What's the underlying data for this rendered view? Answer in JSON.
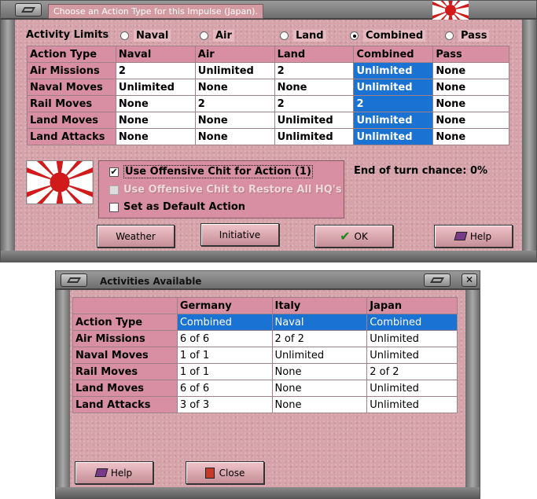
{
  "impulse_window": {
    "title": "Choose an Action Type for this Impulse (Japan).",
    "activity_limits_label": "Activity Limits",
    "radios": [
      {
        "label": "Naval",
        "selected": false
      },
      {
        "label": "Air",
        "selected": false
      },
      {
        "label": "Land",
        "selected": false
      },
      {
        "label": "Combined",
        "selected": true
      },
      {
        "label": "Pass",
        "selected": false
      }
    ],
    "table_headers": [
      "Action Type",
      "Naval",
      "Air",
      "Land",
      "Combined",
      "Pass"
    ],
    "rows": [
      {
        "label": "Air Missions",
        "cells": [
          "2",
          "Unlimited",
          "2",
          "Unlimited",
          "None"
        ]
      },
      {
        "label": "Naval Moves",
        "cells": [
          "Unlimited",
          "None",
          "None",
          "Unlimited",
          "None"
        ]
      },
      {
        "label": "Rail Moves",
        "cells": [
          "None",
          "2",
          "2",
          "2",
          "None"
        ]
      },
      {
        "label": "Land Moves",
        "cells": [
          "None",
          "None",
          "Unlimited",
          "Unlimited",
          "None"
        ]
      },
      {
        "label": "Land Attacks",
        "cells": [
          "None",
          "None",
          "Unlimited",
          "Unlimited",
          "None"
        ]
      }
    ],
    "options": [
      {
        "label": "Use Offensive Chit for Action (1)",
        "checked": true,
        "enabled": true
      },
      {
        "label": "Use Offensive Chit to Restore All HQ's",
        "checked": false,
        "enabled": false
      },
      {
        "label": "Set as Default Action",
        "checked": false,
        "enabled": true
      }
    ],
    "end_of_turn": "End of turn chance: 0%",
    "buttons": {
      "weather": "Weather",
      "initiative": "Initiative",
      "ok": "OK",
      "help": "Help"
    }
  },
  "activities_window": {
    "title": "Activities Available",
    "headers": [
      "Germany",
      "Italy",
      "Japan"
    ],
    "action_type_label": "Action Type",
    "action_types": [
      "Combined",
      "Naval",
      "Combined"
    ],
    "rows": [
      {
        "label": "Air Missions",
        "cells": [
          "6 of 6",
          "2 of 2",
          "Unlimited"
        ]
      },
      {
        "label": "Naval Moves",
        "cells": [
          "1 of 1",
          "Unlimited",
          "Unlimited"
        ]
      },
      {
        "label": "Rail Moves",
        "cells": [
          "1 of 1",
          "None",
          "2 of 2"
        ]
      },
      {
        "label": "Land Moves",
        "cells": [
          "6 of 6",
          "None",
          "Unlimited"
        ]
      },
      {
        "label": "Land Attacks",
        "cells": [
          "3 of 3",
          "None",
          "Unlimited"
        ]
      }
    ],
    "buttons": {
      "help": "Help",
      "close": "Close"
    }
  },
  "colors": {
    "selection": "#1a72d2",
    "header_pink": "#d98fa3",
    "flag_red": "#d11a1a"
  }
}
